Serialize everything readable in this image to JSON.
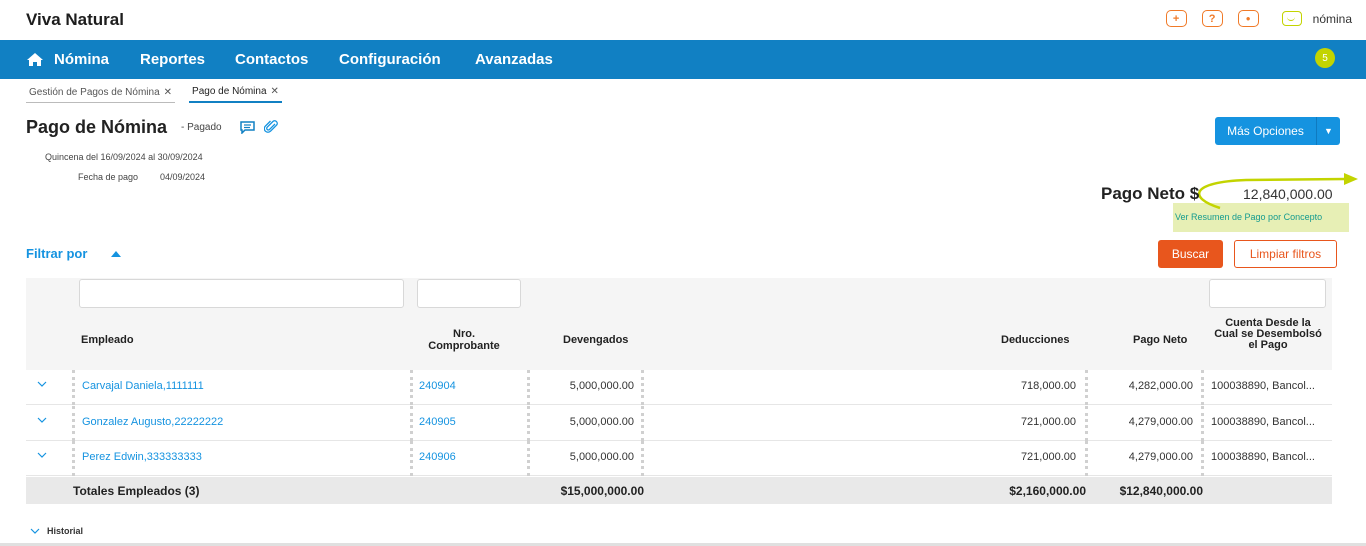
{
  "app": {
    "title": "Viva Natural",
    "product_name": "nómina",
    "accent": "#1180c3",
    "lime": "#c3d400",
    "orange": "#e8561d"
  },
  "top_icons": [
    {
      "icon": "plus-icon",
      "glyph": "+"
    },
    {
      "icon": "help-icon",
      "glyph": "?"
    },
    {
      "icon": "user-icon",
      "glyph": "●"
    }
  ],
  "nav": {
    "items": [
      "Nómina",
      "Reportes",
      "Contactos",
      "Configuración",
      "Avanzadas"
    ],
    "notification_count": "5"
  },
  "tabs": [
    {
      "label": "Gestión de Pagos de Nómina",
      "close": "✕"
    },
    {
      "label": "Pago de Nómina",
      "close": "✕"
    }
  ],
  "header": {
    "title": "Pago de Nómina",
    "status": "- Pagado",
    "period": "Quincena del 16/09/2024 al 30/09/2024",
    "pay_date_label": "Fecha de pago",
    "pay_date_value": "04/09/2024",
    "more_options": "Más Opciones",
    "net_pay_label": "Pago Neto $",
    "net_pay_value": "12,840,000.00",
    "summary_link": "Ver Resumen de Pago por Concepto"
  },
  "filter": {
    "label": "Filtrar por",
    "search_button": "Buscar",
    "clear_button": "Limpiar filtros"
  },
  "table": {
    "columns": {
      "employee": "Empleado",
      "voucher": "Nro. Comprobante",
      "earnings": "Devengados",
      "deductions": "Deducciones",
      "net_pay": "Pago Neto",
      "account": "Cuenta Desde la Cual se Desembolsó el Pago"
    },
    "rows": [
      {
        "employee": "Carvajal Daniela,1111111",
        "voucher": "240904",
        "earnings": "5,000,000.00",
        "deductions": "718,000.00",
        "net_pay": "4,282,000.00",
        "account": "100038890, Bancol..."
      },
      {
        "employee": "Gonzalez Augusto,22222222",
        "voucher": "240905",
        "earnings": "5,000,000.00",
        "deductions": "721,000.00",
        "net_pay": "4,279,000.00",
        "account": "100038890, Bancol..."
      },
      {
        "employee": "Perez Edwin,333333333",
        "voucher": "240906",
        "earnings": "5,000,000.00",
        "deductions": "721,000.00",
        "net_pay": "4,279,000.00",
        "account": "100038890, Bancol..."
      }
    ],
    "totals": {
      "label": "Totales Empleados (3)",
      "earnings": "$15,000,000.00",
      "deductions": "$2,160,000.00",
      "net_pay": "$12,840,000.00"
    }
  },
  "historial": "Historial"
}
